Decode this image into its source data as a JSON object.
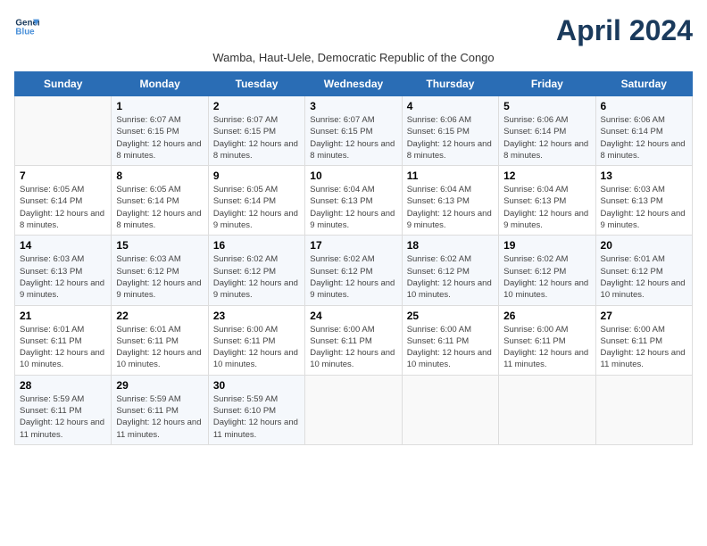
{
  "logo": {
    "line1": "General",
    "line2": "Blue"
  },
  "title": "April 2024",
  "subtitle": "Wamba, Haut-Uele, Democratic Republic of the Congo",
  "days_of_week": [
    "Sunday",
    "Monday",
    "Tuesday",
    "Wednesday",
    "Thursday",
    "Friday",
    "Saturday"
  ],
  "weeks": [
    [
      {
        "day": "",
        "sunrise": "",
        "sunset": "",
        "daylight": ""
      },
      {
        "day": "1",
        "sunrise": "Sunrise: 6:07 AM",
        "sunset": "Sunset: 6:15 PM",
        "daylight": "Daylight: 12 hours and 8 minutes."
      },
      {
        "day": "2",
        "sunrise": "Sunrise: 6:07 AM",
        "sunset": "Sunset: 6:15 PM",
        "daylight": "Daylight: 12 hours and 8 minutes."
      },
      {
        "day": "3",
        "sunrise": "Sunrise: 6:07 AM",
        "sunset": "Sunset: 6:15 PM",
        "daylight": "Daylight: 12 hours and 8 minutes."
      },
      {
        "day": "4",
        "sunrise": "Sunrise: 6:06 AM",
        "sunset": "Sunset: 6:15 PM",
        "daylight": "Daylight: 12 hours and 8 minutes."
      },
      {
        "day": "5",
        "sunrise": "Sunrise: 6:06 AM",
        "sunset": "Sunset: 6:14 PM",
        "daylight": "Daylight: 12 hours and 8 minutes."
      },
      {
        "day": "6",
        "sunrise": "Sunrise: 6:06 AM",
        "sunset": "Sunset: 6:14 PM",
        "daylight": "Daylight: 12 hours and 8 minutes."
      }
    ],
    [
      {
        "day": "7",
        "sunrise": "Sunrise: 6:05 AM",
        "sunset": "Sunset: 6:14 PM",
        "daylight": "Daylight: 12 hours and 8 minutes."
      },
      {
        "day": "8",
        "sunrise": "Sunrise: 6:05 AM",
        "sunset": "Sunset: 6:14 PM",
        "daylight": "Daylight: 12 hours and 8 minutes."
      },
      {
        "day": "9",
        "sunrise": "Sunrise: 6:05 AM",
        "sunset": "Sunset: 6:14 PM",
        "daylight": "Daylight: 12 hours and 9 minutes."
      },
      {
        "day": "10",
        "sunrise": "Sunrise: 6:04 AM",
        "sunset": "Sunset: 6:13 PM",
        "daylight": "Daylight: 12 hours and 9 minutes."
      },
      {
        "day": "11",
        "sunrise": "Sunrise: 6:04 AM",
        "sunset": "Sunset: 6:13 PM",
        "daylight": "Daylight: 12 hours and 9 minutes."
      },
      {
        "day": "12",
        "sunrise": "Sunrise: 6:04 AM",
        "sunset": "Sunset: 6:13 PM",
        "daylight": "Daylight: 12 hours and 9 minutes."
      },
      {
        "day": "13",
        "sunrise": "Sunrise: 6:03 AM",
        "sunset": "Sunset: 6:13 PM",
        "daylight": "Daylight: 12 hours and 9 minutes."
      }
    ],
    [
      {
        "day": "14",
        "sunrise": "Sunrise: 6:03 AM",
        "sunset": "Sunset: 6:13 PM",
        "daylight": "Daylight: 12 hours and 9 minutes."
      },
      {
        "day": "15",
        "sunrise": "Sunrise: 6:03 AM",
        "sunset": "Sunset: 6:12 PM",
        "daylight": "Daylight: 12 hours and 9 minutes."
      },
      {
        "day": "16",
        "sunrise": "Sunrise: 6:02 AM",
        "sunset": "Sunset: 6:12 PM",
        "daylight": "Daylight: 12 hours and 9 minutes."
      },
      {
        "day": "17",
        "sunrise": "Sunrise: 6:02 AM",
        "sunset": "Sunset: 6:12 PM",
        "daylight": "Daylight: 12 hours and 9 minutes."
      },
      {
        "day": "18",
        "sunrise": "Sunrise: 6:02 AM",
        "sunset": "Sunset: 6:12 PM",
        "daylight": "Daylight: 12 hours and 10 minutes."
      },
      {
        "day": "19",
        "sunrise": "Sunrise: 6:02 AM",
        "sunset": "Sunset: 6:12 PM",
        "daylight": "Daylight: 12 hours and 10 minutes."
      },
      {
        "day": "20",
        "sunrise": "Sunrise: 6:01 AM",
        "sunset": "Sunset: 6:12 PM",
        "daylight": "Daylight: 12 hours and 10 minutes."
      }
    ],
    [
      {
        "day": "21",
        "sunrise": "Sunrise: 6:01 AM",
        "sunset": "Sunset: 6:11 PM",
        "daylight": "Daylight: 12 hours and 10 minutes."
      },
      {
        "day": "22",
        "sunrise": "Sunrise: 6:01 AM",
        "sunset": "Sunset: 6:11 PM",
        "daylight": "Daylight: 12 hours and 10 minutes."
      },
      {
        "day": "23",
        "sunrise": "Sunrise: 6:00 AM",
        "sunset": "Sunset: 6:11 PM",
        "daylight": "Daylight: 12 hours and 10 minutes."
      },
      {
        "day": "24",
        "sunrise": "Sunrise: 6:00 AM",
        "sunset": "Sunset: 6:11 PM",
        "daylight": "Daylight: 12 hours and 10 minutes."
      },
      {
        "day": "25",
        "sunrise": "Sunrise: 6:00 AM",
        "sunset": "Sunset: 6:11 PM",
        "daylight": "Daylight: 12 hours and 10 minutes."
      },
      {
        "day": "26",
        "sunrise": "Sunrise: 6:00 AM",
        "sunset": "Sunset: 6:11 PM",
        "daylight": "Daylight: 12 hours and 11 minutes."
      },
      {
        "day": "27",
        "sunrise": "Sunrise: 6:00 AM",
        "sunset": "Sunset: 6:11 PM",
        "daylight": "Daylight: 12 hours and 11 minutes."
      }
    ],
    [
      {
        "day": "28",
        "sunrise": "Sunrise: 5:59 AM",
        "sunset": "Sunset: 6:11 PM",
        "daylight": "Daylight: 12 hours and 11 minutes."
      },
      {
        "day": "29",
        "sunrise": "Sunrise: 5:59 AM",
        "sunset": "Sunset: 6:11 PM",
        "daylight": "Daylight: 12 hours and 11 minutes."
      },
      {
        "day": "30",
        "sunrise": "Sunrise: 5:59 AM",
        "sunset": "Sunset: 6:10 PM",
        "daylight": "Daylight: 12 hours and 11 minutes."
      },
      {
        "day": "",
        "sunrise": "",
        "sunset": "",
        "daylight": ""
      },
      {
        "day": "",
        "sunrise": "",
        "sunset": "",
        "daylight": ""
      },
      {
        "day": "",
        "sunrise": "",
        "sunset": "",
        "daylight": ""
      },
      {
        "day": "",
        "sunrise": "",
        "sunset": "",
        "daylight": ""
      }
    ]
  ]
}
